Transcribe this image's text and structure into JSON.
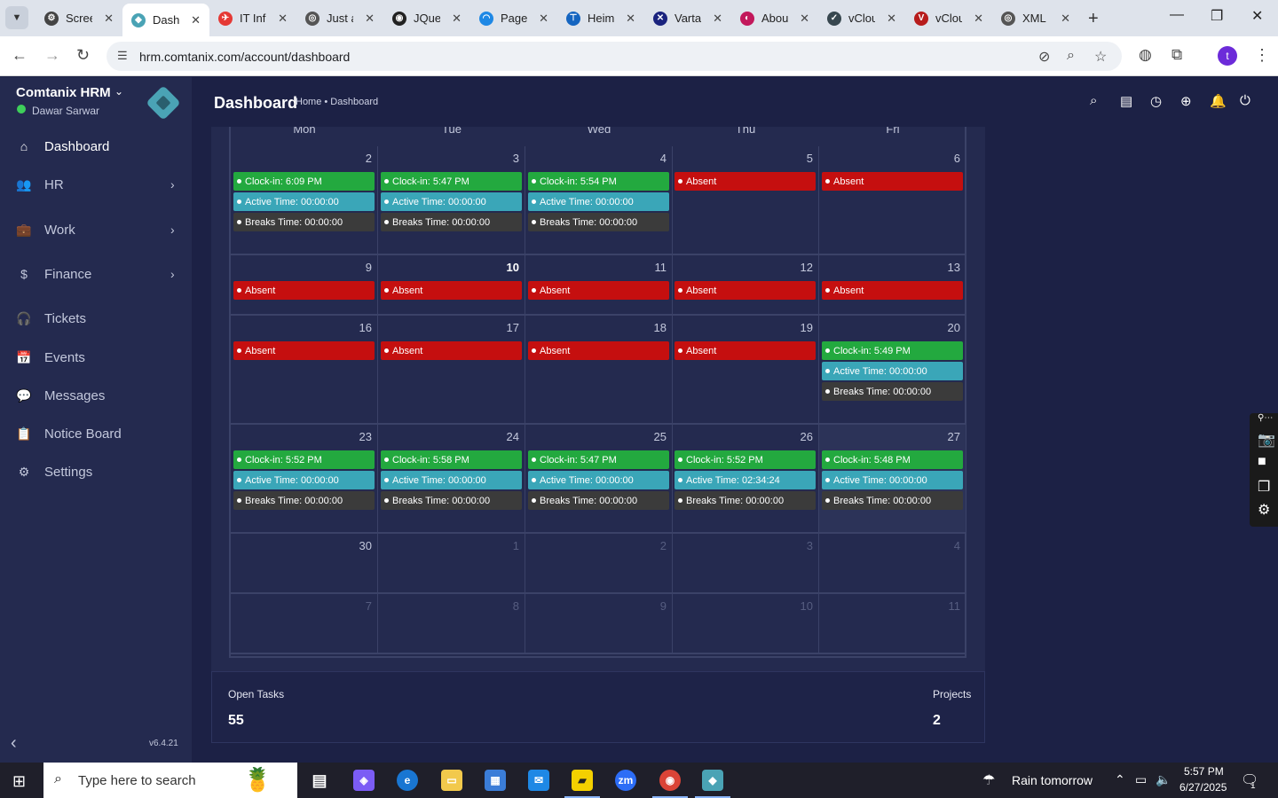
{
  "browser": {
    "tabs": [
      {
        "title": "Screenshot",
        "color": "#444444",
        "glyph": "⚙"
      },
      {
        "title": "Dashboard",
        "color": "#4aa3b5",
        "glyph": "◆"
      },
      {
        "title": "IT Infrastructure",
        "color": "#e53935",
        "glyph": "✈"
      },
      {
        "title": "Just a moment",
        "color": "#555555",
        "glyph": "◎"
      },
      {
        "title": "JQuery",
        "color": "#222222",
        "glyph": "◉"
      },
      {
        "title": "Page",
        "color": "#1e88e5",
        "glyph": "◠"
      },
      {
        "title": "Heim",
        "color": "#1565c0",
        "glyph": "⊤"
      },
      {
        "title": "Varta",
        "color": "#1a237e",
        "glyph": "✕"
      },
      {
        "title": "About",
        "color": "#c2185b",
        "glyph": "◐"
      },
      {
        "title": "vCloud",
        "color": "#37474f",
        "glyph": "✓"
      },
      {
        "title": "vCloud",
        "color": "#b71c1c",
        "glyph": "V"
      },
      {
        "title": "XML",
        "color": "#555555",
        "glyph": "◎"
      }
    ],
    "url": "hrm.comtanix.com/account/dashboard",
    "profile_initial": "t"
  },
  "sidebar": {
    "brand": "Comtanix HRM",
    "user": "Dawar Sarwar",
    "items": [
      {
        "label": "Dashboard",
        "icon": "⌂",
        "chevron": false,
        "active": true
      },
      {
        "label": "HR",
        "icon": "👥",
        "chevron": true,
        "active": false
      },
      {
        "label": "Work",
        "icon": "💼",
        "chevron": true,
        "active": false
      },
      {
        "label": "Finance",
        "icon": "$",
        "chevron": true,
        "active": false
      },
      {
        "label": "Tickets",
        "icon": "🎧",
        "chevron": false,
        "active": false
      },
      {
        "label": "Events",
        "icon": "📅",
        "chevron": false,
        "active": false
      },
      {
        "label": "Messages",
        "icon": "💬",
        "chevron": false,
        "active": false
      },
      {
        "label": "Notice Board",
        "icon": "📋",
        "chevron": false,
        "active": false
      },
      {
        "label": "Settings",
        "icon": "⚙",
        "chevron": false,
        "active": false
      }
    ],
    "version": "v6.4.21"
  },
  "header": {
    "title": "Dashboard",
    "breadcrumb": "Home • Dashboard"
  },
  "calendar": {
    "weekdays": [
      "Mon",
      "Tue",
      "Wed",
      "Thu",
      "Fri"
    ],
    "weeks": [
      [
        {
          "day": "2",
          "events": [
            {
              "type": "clock",
              "text": "Clock-in: 6:09 PM"
            },
            {
              "type": "active",
              "text": "Active Time: 00:00:00"
            },
            {
              "type": "break",
              "text": "Breaks Time: 00:00:00"
            }
          ]
        },
        {
          "day": "3",
          "events": [
            {
              "type": "clock",
              "text": "Clock-in: 5:47 PM"
            },
            {
              "type": "active",
              "text": "Active Time: 00:00:00"
            },
            {
              "type": "break",
              "text": "Breaks Time: 00:00:00"
            }
          ]
        },
        {
          "day": "4",
          "events": [
            {
              "type": "clock",
              "text": "Clock-in: 5:54 PM"
            },
            {
              "type": "active",
              "text": "Active Time: 00:00:00"
            },
            {
              "type": "break",
              "text": "Breaks Time: 00:00:00"
            }
          ]
        },
        {
          "day": "5",
          "events": [
            {
              "type": "absent",
              "text": "Absent"
            }
          ]
        },
        {
          "day": "6",
          "events": [
            {
              "type": "absent",
              "text": "Absent"
            }
          ]
        }
      ],
      [
        {
          "day": "9",
          "events": [
            {
              "type": "absent",
              "text": "Absent"
            }
          ]
        },
        {
          "day": "10",
          "bold": true,
          "events": [
            {
              "type": "absent",
              "text": "Absent"
            }
          ]
        },
        {
          "day": "11",
          "events": [
            {
              "type": "absent",
              "text": "Absent"
            }
          ]
        },
        {
          "day": "12",
          "events": [
            {
              "type": "absent",
              "text": "Absent"
            }
          ]
        },
        {
          "day": "13",
          "events": [
            {
              "type": "absent",
              "text": "Absent"
            }
          ]
        }
      ],
      [
        {
          "day": "16",
          "events": [
            {
              "type": "absent",
              "text": "Absent"
            }
          ]
        },
        {
          "day": "17",
          "events": [
            {
              "type": "absent",
              "text": "Absent"
            }
          ]
        },
        {
          "day": "18",
          "events": [
            {
              "type": "absent",
              "text": "Absent"
            }
          ]
        },
        {
          "day": "19",
          "events": [
            {
              "type": "absent",
              "text": "Absent"
            }
          ]
        },
        {
          "day": "20",
          "events": [
            {
              "type": "clock",
              "text": "Clock-in: 5:49 PM"
            },
            {
              "type": "active",
              "text": "Active Time: 00:00:00"
            },
            {
              "type": "break",
              "text": "Breaks Time: 00:00:00"
            }
          ]
        }
      ],
      [
        {
          "day": "23",
          "events": [
            {
              "type": "clock",
              "text": "Clock-in: 5:52 PM"
            },
            {
              "type": "active",
              "text": "Active Time: 00:00:00"
            },
            {
              "type": "break",
              "text": "Breaks Time: 00:00:00"
            }
          ]
        },
        {
          "day": "24",
          "events": [
            {
              "type": "clock",
              "text": "Clock-in: 5:58 PM"
            },
            {
              "type": "active",
              "text": "Active Time: 00:00:00"
            },
            {
              "type": "break",
              "text": "Breaks Time: 00:00:00"
            }
          ]
        },
        {
          "day": "25",
          "events": [
            {
              "type": "clock",
              "text": "Clock-in: 5:47 PM"
            },
            {
              "type": "active",
              "text": "Active Time: 00:00:00"
            },
            {
              "type": "break",
              "text": "Breaks Time: 00:00:00"
            }
          ]
        },
        {
          "day": "26",
          "events": [
            {
              "type": "clock",
              "text": "Clock-in: 5:52 PM"
            },
            {
              "type": "active",
              "text": "Active Time: 02:34:24"
            },
            {
              "type": "break",
              "text": "Breaks Time: 00:00:00"
            }
          ]
        },
        {
          "day": "27",
          "today": true,
          "events": [
            {
              "type": "clock",
              "text": "Clock-in: 5:48 PM"
            },
            {
              "type": "active",
              "text": "Active Time: 00:00:00"
            },
            {
              "type": "break",
              "text": "Breaks Time: 00:00:00"
            }
          ]
        }
      ],
      [
        {
          "day": "30",
          "events": []
        },
        {
          "day": "1",
          "muted": true,
          "events": []
        },
        {
          "day": "2",
          "muted": true,
          "events": []
        },
        {
          "day": "3",
          "muted": true,
          "events": []
        },
        {
          "day": "4",
          "muted": true,
          "events": []
        }
      ],
      [
        {
          "day": "7",
          "muted": true,
          "events": []
        },
        {
          "day": "8",
          "muted": true,
          "events": []
        },
        {
          "day": "9",
          "muted": true,
          "events": []
        },
        {
          "day": "10",
          "muted": true,
          "events": []
        },
        {
          "day": "11",
          "muted": true,
          "events": []
        }
      ]
    ]
  },
  "stats": {
    "open_tasks_label": "Open Tasks",
    "open_tasks_value": "55",
    "projects_label": "Projects",
    "projects_value": "2"
  },
  "taskbar": {
    "search_placeholder": "Type here to search",
    "weather": "Rain tomorrow",
    "time": "5:57 PM",
    "date": "6/27/2025",
    "notification_count": "1"
  },
  "colors": {
    "clock_in": "#23a93f",
    "active_time": "#3aa6b8",
    "breaks_time": "#3b3b3b",
    "absent": "#c50f0f",
    "sidebar_bg": "#242a4f",
    "page_bg": "#1c2145"
  }
}
